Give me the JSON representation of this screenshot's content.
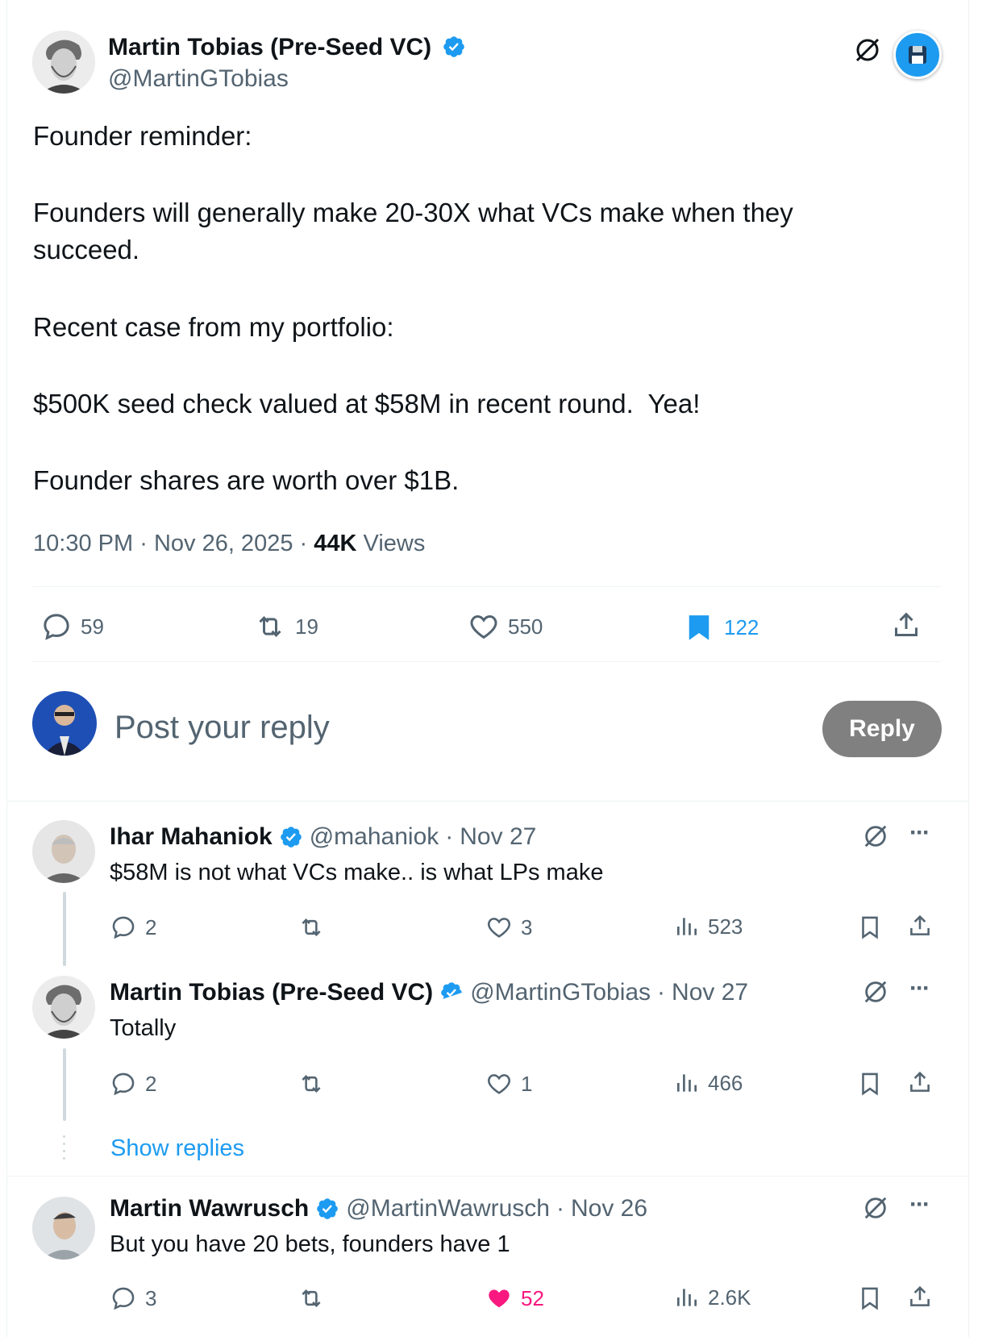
{
  "main_post": {
    "author_name": "Martin Tobias (Pre-Seed VC)",
    "author_handle": "@MartinGTobias",
    "lines": {
      "l1": "Founder reminder:",
      "l2": "Founders will generally make 20-30X what VCs make when they succeed.",
      "l3": "Recent case from my portfolio:",
      "l4": "$500K seed check valued at $58M in recent round.  Yea!",
      "l5": "Founder shares are worth over $1B."
    },
    "time": "10:30 PM",
    "date": "Nov 26, 2025",
    "views_count": "44K",
    "views_label": "Views",
    "stats": {
      "replies": "59",
      "reposts": "19",
      "likes": "550",
      "bookmarks": "122"
    }
  },
  "composer": {
    "placeholder": "Post your reply",
    "reply_button": "Reply"
  },
  "replies": [
    {
      "name": "Ihar Mahaniok",
      "handle": "@mahaniok",
      "date": "Nov 27",
      "text": "$58M is not what VCs make.. is what LPs make",
      "replies": "2",
      "reposts": "",
      "likes": "3",
      "views": "523"
    },
    {
      "name": "Martin Tobias (Pre-Seed VC)",
      "handle": "@MartinGTobias",
      "date": "Nov 27",
      "text": "Totally",
      "replies": "2",
      "reposts": "",
      "likes": "1",
      "views": "466"
    },
    {
      "name": "Martin Wawrusch",
      "handle": "@MartinWawrusch",
      "date": "Nov 26",
      "text": "But you have 20 bets, founders have 1",
      "replies": "3",
      "reposts": "",
      "likes": "52",
      "views": "2.6K"
    }
  ],
  "show_replies_label": "Show replies",
  "separator": "·",
  "colors": {
    "accent": "#1d9bf0",
    "like_active": "#f91880",
    "muted": "#536471",
    "reply_button_bg": "#808080"
  }
}
